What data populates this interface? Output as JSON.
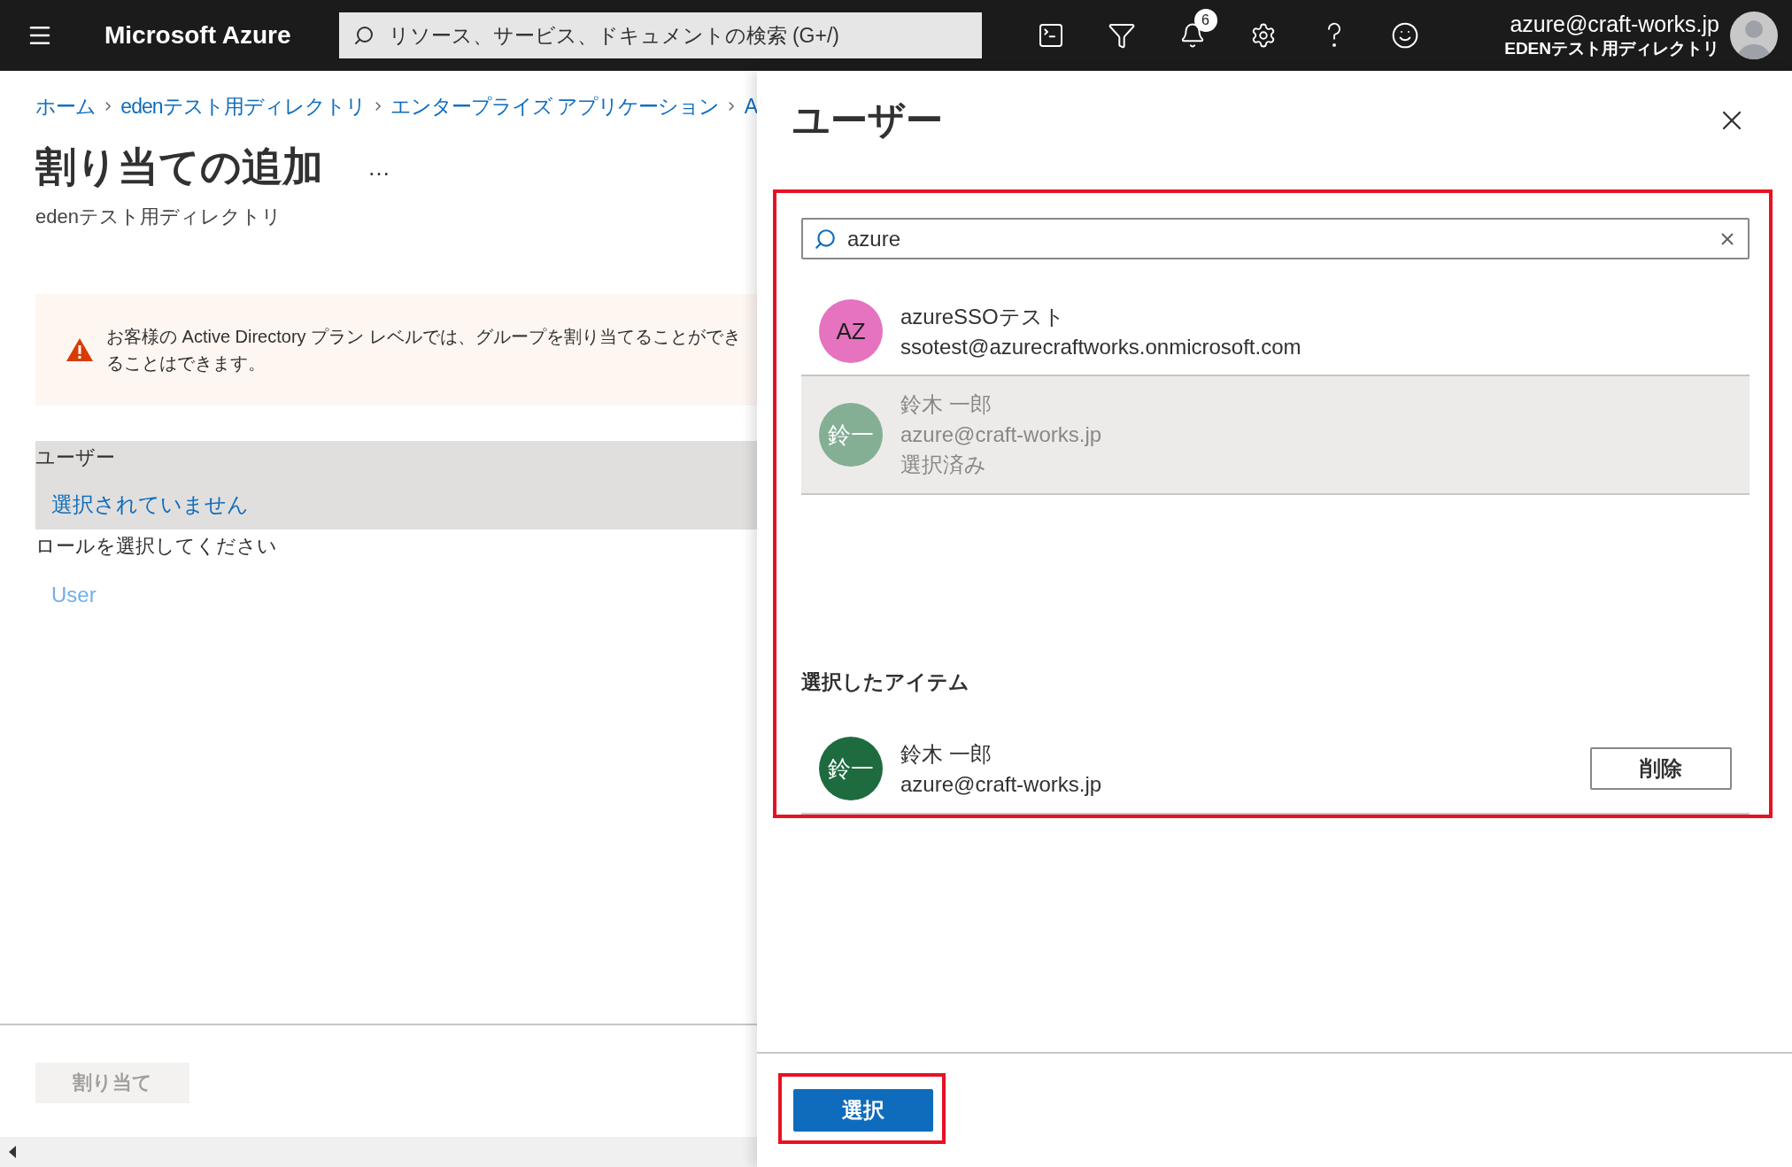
{
  "topbar": {
    "brand": "Microsoft Azure",
    "search": {
      "placeholder": "リソース、サービス、ドキュメントの検索 (G+/)"
    },
    "notifications": "6",
    "account": {
      "email": "azure@craft-works.jp",
      "directory": "EDENテスト用ディレクトリ"
    }
  },
  "breadcrumb": [
    "ホーム",
    "edenテスト用ディレクトリ",
    "エンタープライズ アプリケーション",
    "A"
  ],
  "page": {
    "title": "割り当ての追加",
    "more": "…",
    "subtitle": "edenテスト用ディレクトリ"
  },
  "warning": {
    "lines": [
      "お客様の Active Directory プラン レベルでは、グループを割り当てることができ",
      "ることはできます。"
    ]
  },
  "users_field": {
    "label": "ユーザー",
    "value": "選択されていません"
  },
  "role_field": {
    "label": "ロールを選択してください",
    "value": "User"
  },
  "assign_button": {
    "label": "割り当て",
    "disabled": true
  },
  "panel": {
    "title": "ユーザー",
    "highlighted": true,
    "search": {
      "value": "azure"
    },
    "results": [
      {
        "initials": "AZ",
        "name": "azureSSOテスト",
        "email": "ssotest@azurecraftworks.onmicrosoft.com",
        "color": "#e573c0",
        "selected": false
      },
      {
        "initials": "鈴一",
        "name": "鈴木 一郎",
        "email": "azure@craft-works.jp",
        "note": "選択済み",
        "color": "#84af95",
        "selected": true
      }
    ],
    "selected_heading": "選択したアイテム",
    "selected_items": [
      {
        "initials": "鈴一",
        "name": "鈴木 一郎",
        "email": "azure@craft-works.jp",
        "color": "#1e6b40",
        "action": "削除"
      }
    ],
    "select_button": {
      "label": "選択",
      "highlighted": true
    }
  }
}
